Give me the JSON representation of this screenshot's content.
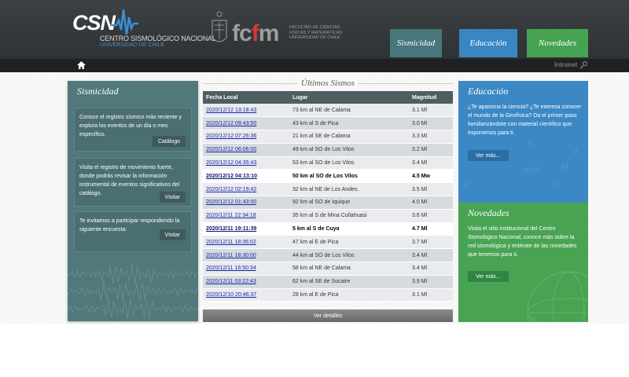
{
  "header": {
    "logo_csn": {
      "big": "CSN",
      "line1": "CENTRO SISMOLÓGICO NACIONAL",
      "line2": "UNIVERSIDAD DE CHILE"
    },
    "logo_fcfm": {
      "mark_left": "fc",
      "mark_f": "f",
      "mark_right": "m",
      "sub": "FACULTAD DE CIENCIAS FÍSICAS Y MATEMÁTICAS UNIVERSIDAD DE CHILE"
    },
    "nav": [
      {
        "label": "Sismicidad",
        "color": "#47777a"
      },
      {
        "label": "Educación",
        "color": "#3a86c2"
      },
      {
        "label": "Novedades",
        "color": "#46a352"
      }
    ],
    "intranet": "Intranet"
  },
  "left_panel": {
    "title": "Sismicidad",
    "boxes": [
      {
        "text": "Conoce el registro sísmico más reciente y explora los eventos de un día o mes específico.",
        "button": "Catálogo"
      },
      {
        "text": "Visita el registro de movimiento fuerte, donde podrás revisar la información instrumental de eventos significativos del catálogo.",
        "button": "Visitar"
      },
      {
        "text": "Te invitamos a participar respondiendo la siguiente encuesta:",
        "button": "Visitar"
      }
    ]
  },
  "center": {
    "title": "Últimos Sismos",
    "headers": [
      "Fecha Local",
      "Lugar",
      "Magnitud"
    ],
    "rows": [
      {
        "fecha": "2020/12/12 13:18:43",
        "lugar": "73 km al NE de Calama",
        "mag": "3.1 Ml",
        "hl": false
      },
      {
        "fecha": "2020/12/12 09:43:50",
        "lugar": "43 km al S de Pica",
        "mag": "3.0 Ml",
        "hl": false
      },
      {
        "fecha": "2020/12/12 07:26:36",
        "lugar": "21 km al SE de Calama",
        "mag": "3.3 Ml",
        "hl": false
      },
      {
        "fecha": "2020/12/12 06:06:00",
        "lugar": "49 km al SO de Los Vilos",
        "mag": "3.2 Ml",
        "hl": false
      },
      {
        "fecha": "2020/12/12 04:35:43",
        "lugar": "53 km al SO de Los Vilos",
        "mag": "3.4 Ml",
        "hl": false
      },
      {
        "fecha": "2020/12/12 04:13:10",
        "lugar": "50 km al SO de Los Vilos",
        "mag": "4.5 Mw",
        "hl": true
      },
      {
        "fecha": "2020/12/12 02:19:42",
        "lugar": "32 km al NE de Los Andes.",
        "mag": "3.5 Ml",
        "hl": false
      },
      {
        "fecha": "2020/12/12 01:43:00",
        "lugar": "92 km al SO de Iquique",
        "mag": "4.0 Ml",
        "hl": false
      },
      {
        "fecha": "2020/12/11 22:34:18",
        "lugar": "35 km al S de Mina Collahuasi",
        "mag": "3.6 Ml",
        "hl": false
      },
      {
        "fecha": "2020/12/11 19:11:39",
        "lugar": "5 km al S de Cuya",
        "mag": "4.7 Ml",
        "hl": true
      },
      {
        "fecha": "2020/12/11 18:36:02",
        "lugar": "47 km al E de Pica",
        "mag": "3.7 Ml",
        "hl": false
      },
      {
        "fecha": "2020/12/11 18:30:00",
        "lugar": "44 km al SO de Los Vilos",
        "mag": "3.4 Ml",
        "hl": false
      },
      {
        "fecha": "2020/12/11 16:50:34",
        "lugar": "58 km al NE de Calama",
        "mag": "3.4 Ml",
        "hl": false
      },
      {
        "fecha": "2020/12/11 03:22:43",
        "lugar": "62 km al SE de Socaire",
        "mag": "3.9 Ml",
        "hl": false
      },
      {
        "fecha": "2020/12/10 20:46:37",
        "lugar": "28 km al E de Pica",
        "mag": "3.1 Ml",
        "hl": false
      }
    ],
    "details_button": "Ver detalles"
  },
  "education": {
    "title": "Educación",
    "text": "¿Te apasiona la ciencia? ¿Te interesa conocer el mundo de la Geofísica? Da el primer paso familiarizándote con material científico que exponemos para ti.",
    "button": "Ver más..."
  },
  "news": {
    "title": "Novedades",
    "text": "Visita el sitio institucional del Centro Sismológico Nacional, conoce más sobre la red sismológica y entérate de las novedades que tenemos para ti.",
    "button": "Ver más..."
  }
}
